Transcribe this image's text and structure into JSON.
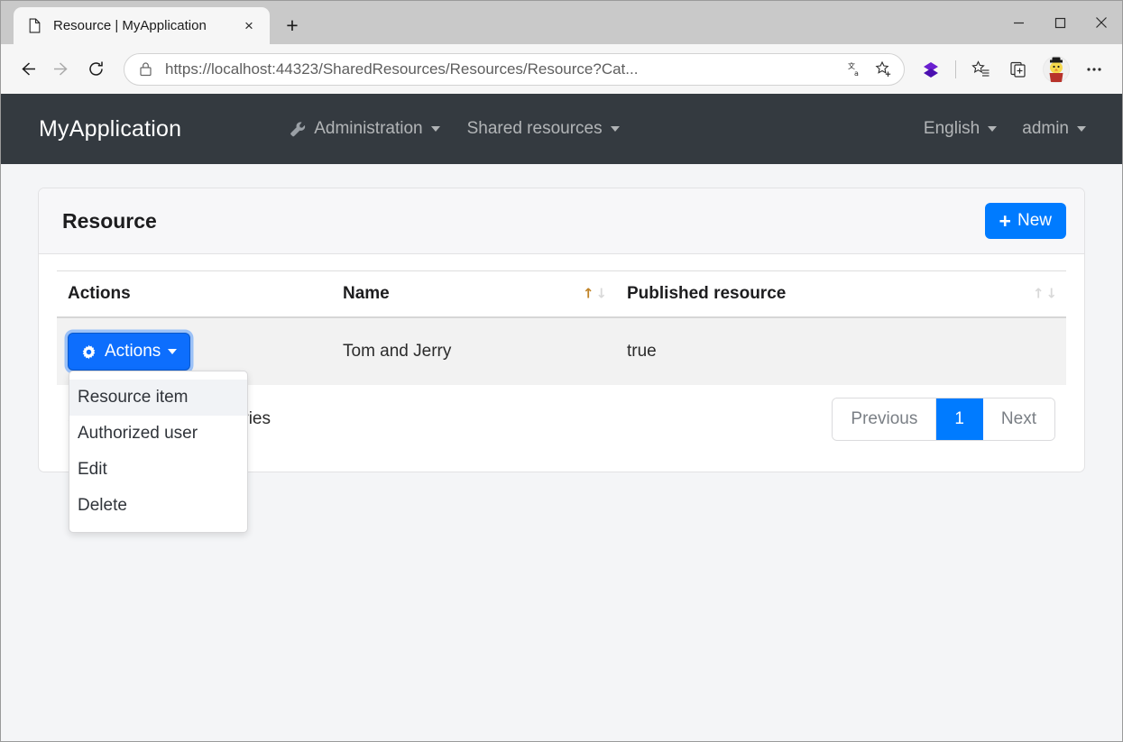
{
  "browser": {
    "tab": {
      "title": "Resource | MyApplication",
      "favicon": "page-icon",
      "close": "×"
    },
    "new_tab_label": "+",
    "window_controls": {
      "minimize": "—",
      "maximize": "☐",
      "close": "✕"
    },
    "nav": {
      "back": "←",
      "forward": "→",
      "reload": "⟳"
    },
    "url": {
      "scheme": "https://",
      "host": "localhost",
      "rest": ":44323/SharedResources/Resources/Resource?Cat...",
      "full": "https://localhost:44323/SharedResources/Resources/Resource?Cat...",
      "lock_icon": "lock-icon"
    },
    "urlbar_actions": [
      {
        "name": "translate-icon",
        "glyph": "文"
      },
      {
        "name": "add-favorite-icon",
        "glyph": "☆"
      }
    ],
    "toolbar": [
      {
        "name": "extension-diamond-icon",
        "glyph": "◆",
        "color": "#5a19c9"
      },
      {
        "name": "favorites-list-icon",
        "glyph": "☆"
      },
      {
        "name": "collections-icon",
        "glyph": "⧉"
      },
      {
        "name": "profile-avatar",
        "glyph": "🐤"
      },
      {
        "name": "settings-more-icon",
        "glyph": "…"
      }
    ]
  },
  "app": {
    "brand": "MyApplication",
    "nav_items": [
      {
        "label": "Administration",
        "icon": "wrench-icon",
        "has_caret": true
      },
      {
        "label": "Shared resources",
        "icon": null,
        "has_caret": true
      }
    ],
    "nav_right": [
      {
        "label": "English",
        "has_caret": true
      },
      {
        "label": "admin",
        "has_caret": true
      }
    ]
  },
  "card": {
    "title": "Resource",
    "new_button": {
      "label": "New",
      "icon": "plus-icon"
    }
  },
  "table": {
    "columns": [
      {
        "label": "Actions",
        "sortable": false
      },
      {
        "label": "Name",
        "sortable": true,
        "sort_state": "active"
      },
      {
        "label": "Published resource",
        "sortable": true,
        "sort_state": "idle"
      }
    ],
    "rows": [
      {
        "actions_label": "Actions",
        "name": "Tom and Jerry",
        "published": "true"
      }
    ],
    "actions_menu": {
      "open": true,
      "items": [
        {
          "label": "Resource item",
          "hovered": true
        },
        {
          "label": "Authorized user",
          "hovered": false
        },
        {
          "label": "Edit",
          "hovered": false
        },
        {
          "label": "Delete",
          "hovered": false
        }
      ]
    },
    "info": "Showing 1 to 1 of 1 entries",
    "pagination": [
      {
        "label": "Previous",
        "active": false
      },
      {
        "label": "1",
        "active": true
      },
      {
        "label": "Next",
        "active": false
      }
    ]
  },
  "colors": {
    "navbar_bg": "#343a40",
    "primary": "#007bff",
    "actions_btn": "#0d6efd",
    "page_bg": "#f4f5f7",
    "row_stripe": "#f2f2f2",
    "sort_active": "#c08327"
  }
}
